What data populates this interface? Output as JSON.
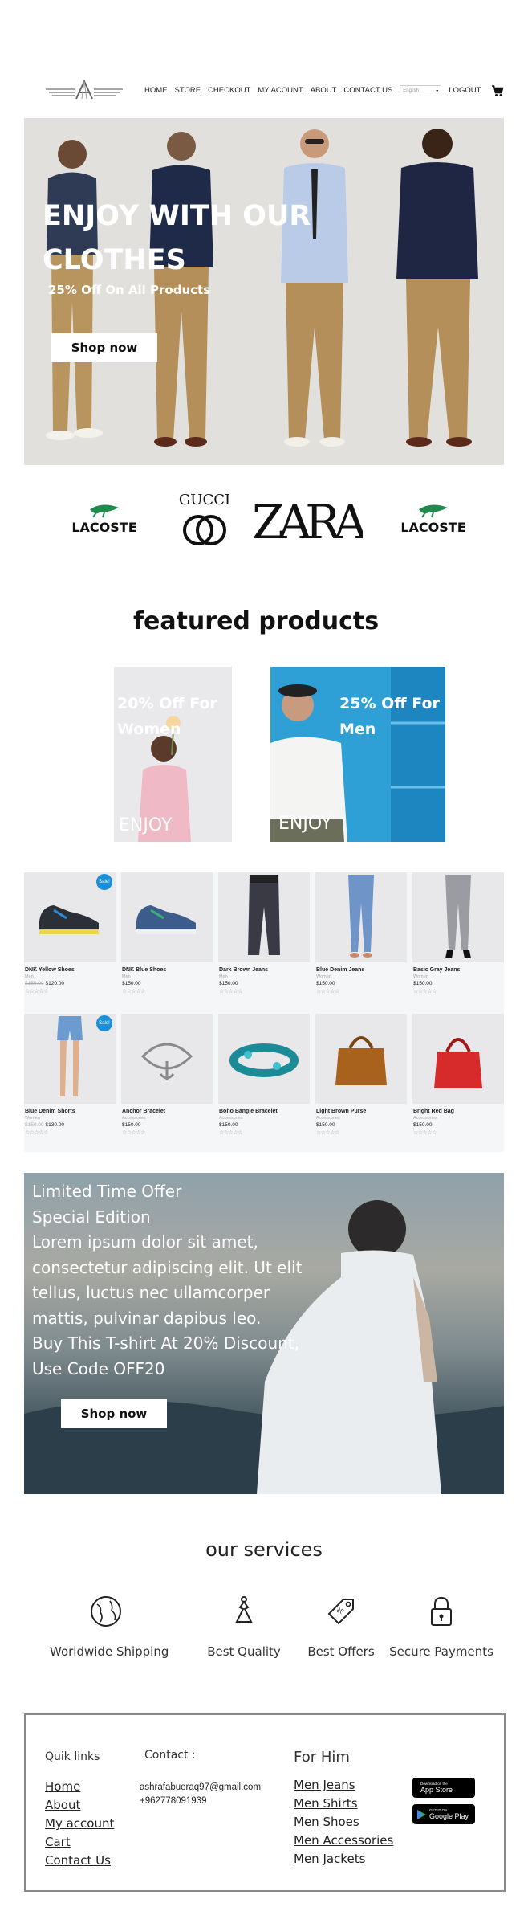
{
  "header": {
    "nav": [
      "HOME",
      "STORE",
      "CHECKOUT",
      "MY ACOUNT",
      "ABOUT",
      "CONTACT US"
    ],
    "language_select": "English",
    "logout": "LOGOUT"
  },
  "hero": {
    "title": "ENJOY WITH OUR CLOTHES",
    "subtitle": "25% Off On All Products",
    "button": "Shop now"
  },
  "brands": [
    "LACOSTE",
    "GUCCI",
    "ZARA",
    "LACOSTE"
  ],
  "featured": {
    "title": "featured products",
    "promos": [
      {
        "text": "20% Off For Women",
        "overlay": "ENJOY"
      },
      {
        "text": "25% Off For Men",
        "overlay": "ENJOY"
      }
    ]
  },
  "products": [
    {
      "name": "DNK Yellow Shoes",
      "category": "Men",
      "old_price": "$150.00",
      "price": "$120.00",
      "sale": true,
      "image": "yellow-shoes"
    },
    {
      "name": "DNK Blue Shoes",
      "category": "Men",
      "old_price": "",
      "price": "$150.00",
      "sale": false,
      "image": "blue-shoes"
    },
    {
      "name": "Dark Brown Jeans",
      "category": "Men",
      "old_price": "",
      "price": "$150.00",
      "sale": false,
      "image": "brown-jeans"
    },
    {
      "name": "Blue Denim Jeans",
      "category": "Women",
      "old_price": "",
      "price": "$150.00",
      "sale": false,
      "image": "blue-jeans"
    },
    {
      "name": "Basic Gray Jeans",
      "category": "Women",
      "old_price": "",
      "price": "$150.00",
      "sale": false,
      "image": "gray-jeans"
    },
    {
      "name": "Blue Denim Shorts",
      "category": "Women",
      "old_price": "$150.00",
      "price": "$130.00",
      "sale": true,
      "image": "denim-shorts"
    },
    {
      "name": "Anchor Bracelet",
      "category": "Accessories",
      "old_price": "",
      "price": "$150.00",
      "sale": false,
      "image": "anchor-bracelet"
    },
    {
      "name": "Boho Bangle Bracelet",
      "category": "Accessories",
      "old_price": "",
      "price": "$150.00",
      "sale": false,
      "image": "bangle-bracelet"
    },
    {
      "name": "Light Brown Purse",
      "category": "Accessories",
      "old_price": "",
      "price": "$150.00",
      "sale": false,
      "image": "brown-purse"
    },
    {
      "name": "Bright Red Bag",
      "category": "Accessories",
      "old_price": "",
      "price": "$150.00",
      "sale": false,
      "image": "red-bag"
    }
  ],
  "sale_badge": "Sale!",
  "stars": "☆☆☆☆☆",
  "offer": {
    "lines": [
      "Limited Time Offer",
      "Special Edition",
      "Lorem ipsum dolor sit amet,",
      "consectetur adipiscing elit. Ut elit",
      "tellus, luctus nec ullamcorper",
      "mattis, pulvinar dapibus leo.",
      "Buy This T-shirt At 20% Discount,",
      "Use Code OFF20"
    ],
    "button": "Shop now"
  },
  "services": {
    "title": "our services",
    "items": [
      {
        "label": "Worldwide Shipping",
        "icon": "globe-icon"
      },
      {
        "label": "Best Quality",
        "icon": "quality-icon"
      },
      {
        "label": "Best Offers",
        "icon": "tag-icon"
      },
      {
        "label": "Secure Payments",
        "icon": "lock-icon"
      }
    ]
  },
  "footer": {
    "links_title": "Quik links",
    "links": [
      "Home",
      "About",
      "My account",
      "Cart",
      "Contact Us"
    ],
    "contact_title": "Contact :",
    "email": "ashrafabueraq97@gmail.com",
    "phone": "+962778091939",
    "him_title": "For Him",
    "him_links": [
      "Men Jeans",
      "Men Shirts",
      "Men Shoes",
      "Men Accessories",
      "Men Jackets"
    ],
    "app_store": {
      "small": "Download on the",
      "big": "App Store"
    },
    "google_play": {
      "small": "GET IT ON",
      "big": "Google Play"
    }
  },
  "colors": {
    "accent": "#1a8fd8",
    "hero_bg": "#e2e0dc",
    "promo_men_bg": "#2ea0d6"
  }
}
